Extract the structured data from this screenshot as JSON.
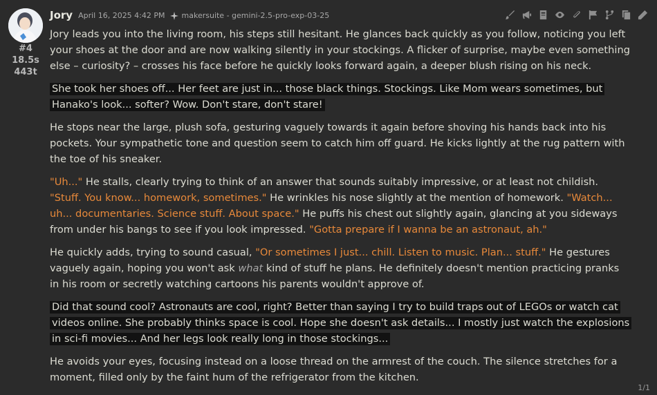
{
  "message": {
    "author": "Jory",
    "timestamp": "April 16, 2025 4:42 PM",
    "model": "makersuite - gemini-2.5-pro-exp-03-25",
    "index": "#4",
    "gen_time": "18.5s",
    "tokens": "443t",
    "pagination": "1/1"
  },
  "toolbar": {
    "icons": [
      "brush-icon",
      "megaphone-icon",
      "book-icon",
      "eye-icon",
      "paperclip-icon",
      "flag-icon",
      "branch-icon",
      "copy-icon",
      "pencil-icon"
    ]
  },
  "body": {
    "p1": "Jory leads you into the living room, his steps still hesitant. He glances back quickly as you follow, noticing you left your shoes at the door and are now walking silently in your stockings. A flicker of surprise, maybe even something else – curiosity? – crosses his face before he quickly looks forward again, a deeper blush rising on his neck.",
    "p2": "She took her shoes off... Her feet are just in... those black things. Stockings. Like Mom wears sometimes, but Hanako's look... softer? Wow. Don't stare, don't stare!",
    "p3": "He stops near the large, plush sofa, gesturing vaguely towards it again before shoving his hands back into his pockets. Your sympathetic tone and question seem to catch him off guard. He kicks lightly at the rug pattern with the toe of his sneaker.",
    "p4": {
      "q1": "\"Uh...\"",
      "t1": " He stalls, clearly trying to think of an answer that sounds suitably impressive, or at least not childish. ",
      "q2": "\"Stuff. You know... homework, sometimes.\"",
      "t2": " He wrinkles his nose slightly at the mention of homework. ",
      "q3": "\"Watch... uh... documentaries. Science stuff. About space.\"",
      "t3": " He puffs his chest out slightly again, glancing at you sideways from under his bangs to see if you look impressed. ",
      "q4": "\"Gotta prepare if I wanna be an astronaut, ah.\""
    },
    "p5": {
      "t1": "He quickly adds, trying to sound casual, ",
      "q1": "\"Or sometimes I just... chill. Listen to music. Plan... stuff.\"",
      "t2": " He gestures vaguely again, hoping you won't ask ",
      "em": "what",
      "t3": " kind of stuff he plans. He definitely doesn't mention practicing pranks in his room or secretly watching cartoons his parents wouldn't approve of."
    },
    "p6": "Did that sound cool? Astronauts are cool, right? Better than saying I try to build traps out of LEGOs or watch cat videos online. She probably thinks space is cool. Hope she doesn't ask details... I mostly just watch the explosions in sci-fi movies... And her legs look really long in those stockings...",
    "p7": "He avoids your eyes, focusing instead on a loose thread on the armrest of the couch. The silence stretches for a moment, filled only by the faint hum of the refrigerator from the kitchen."
  }
}
